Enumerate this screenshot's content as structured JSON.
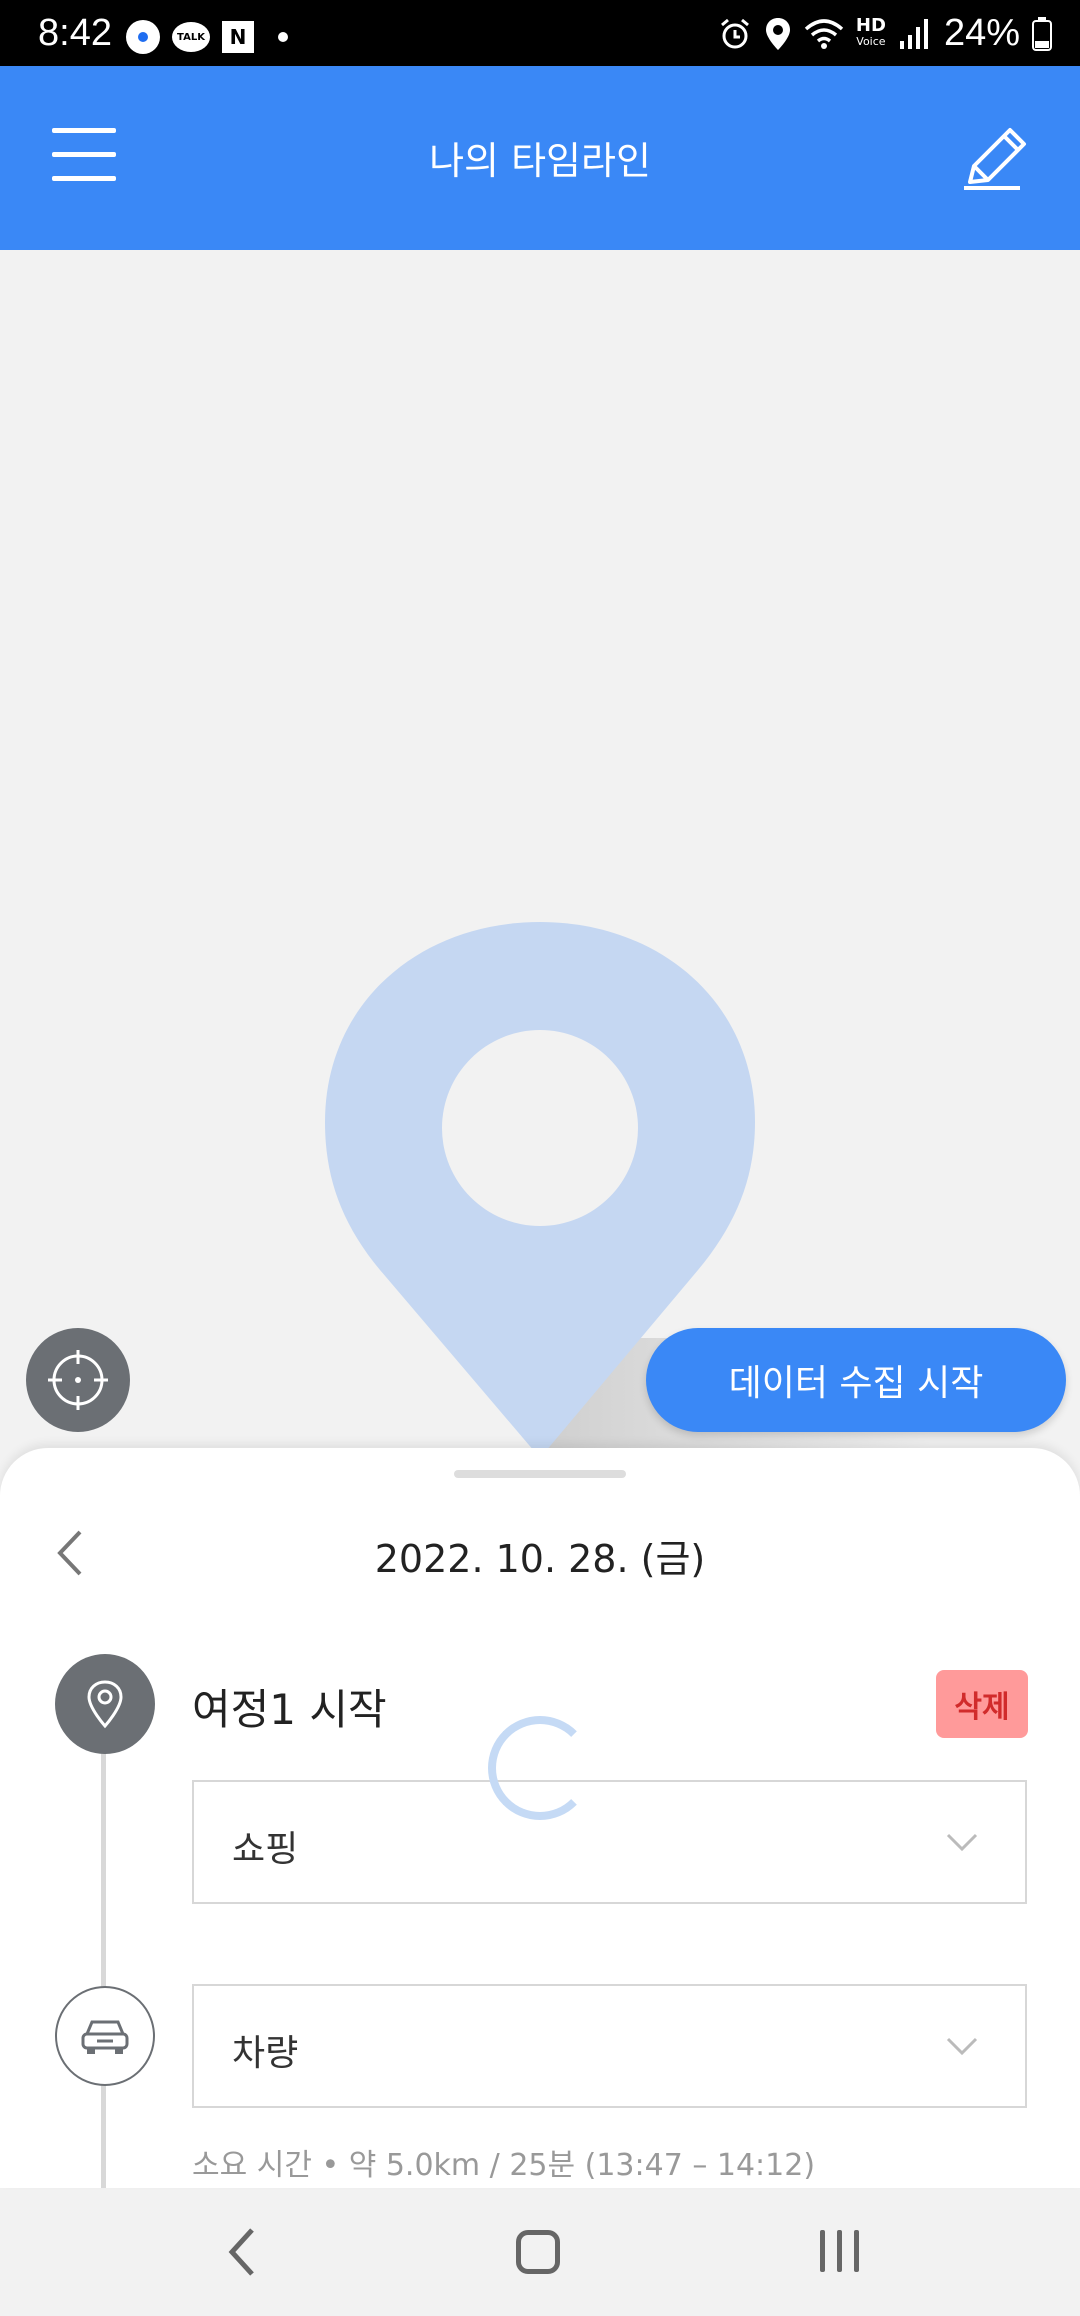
{
  "status_bar": {
    "time": "8:42",
    "battery_percent": "24%",
    "hd_label": "HD",
    "voice_label": "Voice",
    "talk_label": "TALK",
    "n_label": "N"
  },
  "app_bar": {
    "title": "나의 타임라인"
  },
  "actions": {
    "collect_button_label": "데이터 수집 시작"
  },
  "sheet": {
    "date_label": "2022. 10. 28. (금)",
    "trip_title": "여정1 시작",
    "delete_label": "삭제",
    "category_value": "쇼핑",
    "transport_value": "차량",
    "duration_text": "소요 시간  •  약 5.0km / 25분 (13:47 – 14:12)"
  },
  "colors": {
    "primary": "#3a88f6",
    "pin": "#c5d7f2",
    "delete_bg": "#ff9a9a",
    "delete_text": "#d12b2b",
    "node_gray": "#6b6f74"
  },
  "icons": {
    "menu": "hamburger-icon",
    "edit": "pencil-icon",
    "locate": "crosshair-icon",
    "location": "location-pin-icon",
    "car": "car-icon",
    "chevron": "chevron-down-icon"
  }
}
